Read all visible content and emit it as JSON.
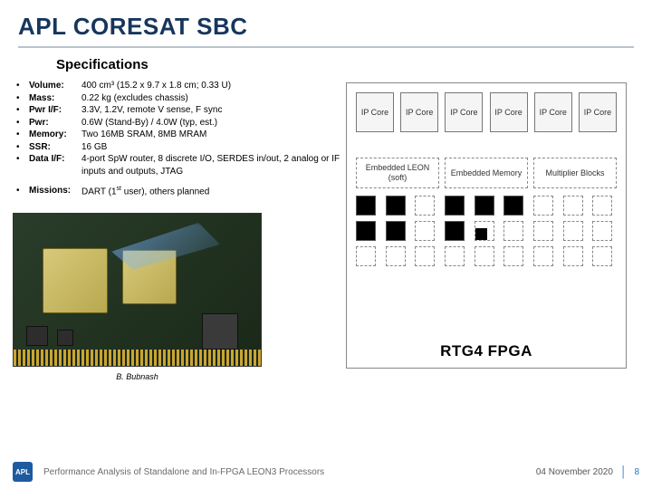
{
  "title": "APL CORESAT SBC",
  "specs_heading": "Specifications",
  "specs": [
    {
      "label": "Volume:",
      "value": "400 cm³ (15.2 x 9.7 x 1.8 cm; 0.33 U)"
    },
    {
      "label": "Mass:",
      "value": "0.22 kg (excludes chassis)"
    },
    {
      "label": "Pwr I/F:",
      "value": "3.3V, 1.2V, remote V sense, F sync"
    },
    {
      "label": "Pwr:",
      "value": "0.6W (Stand-By) / 4.0W (typ, est.)"
    },
    {
      "label": "Memory:",
      "value": "Two 16MB SRAM, 8MB MRAM"
    },
    {
      "label": "SSR:",
      "value": "16 GB"
    },
    {
      "label": "Data I/F:",
      "value": "4-port SpW router, 8 discrete I/O, SERDES in/out, 2 analog or IF inputs and outputs, JTAG"
    }
  ],
  "missions": {
    "label": "Missions:",
    "value_html": "DART (1<sup>st</sup> user), others planned"
  },
  "credit": "B. Bubnash",
  "fpga": {
    "ip_core": "IP Core",
    "ip_core_count": 6,
    "groups": [
      {
        "name": "Embedded LEON (soft)"
      },
      {
        "name": "Embedded Memory"
      },
      {
        "name": "Multiplier Blocks"
      }
    ],
    "title": "RTG4 FPGA"
  },
  "footer": {
    "logo": "APL",
    "title": "Performance Analysis of Standalone and In-FPGA LEON3 Processors",
    "date": "04 November 2020",
    "page": "8"
  }
}
